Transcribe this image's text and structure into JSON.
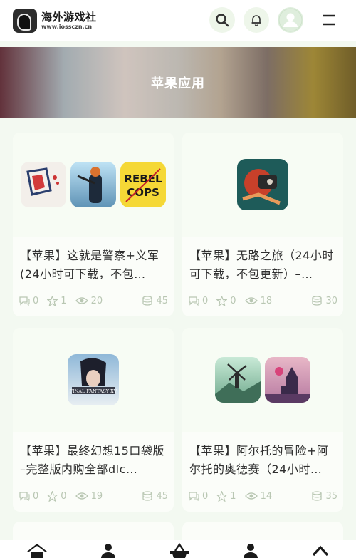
{
  "header": {
    "logo_title": "海外游戏社",
    "logo_sub": "www.iossczn.cn"
  },
  "banner": {
    "title": "苹果应用"
  },
  "cards": [
    {
      "title": "【苹果】这就是警察+义军(24小时可下载，不包…",
      "comments": "0",
      "stars": "1",
      "views": "20",
      "coins": "45"
    },
    {
      "title": "【苹果】无路之旅（24小时可下载，不包更新）–…",
      "comments": "0",
      "stars": "0",
      "views": "18",
      "coins": "30"
    },
    {
      "title": "【苹果】最终幻想15口袋版 –完整版内购全部dlc…",
      "comments": "0",
      "stars": "0",
      "views": "19",
      "coins": "45"
    },
    {
      "title": "【苹果】阿尔托的冒险+阿尔托的奥德赛（24小时…",
      "comments": "0",
      "stars": "1",
      "views": "14",
      "coins": "35"
    }
  ],
  "icons": {
    "rebel_cops_line1": "REBEL",
    "rebel_cops_line2": "COPS",
    "ff15_label": "FINAL FANTASY XV"
  },
  "colors": {
    "accent": "#6fbf5f",
    "meta": "#b9c7b3",
    "background": "#f3f9f1"
  }
}
